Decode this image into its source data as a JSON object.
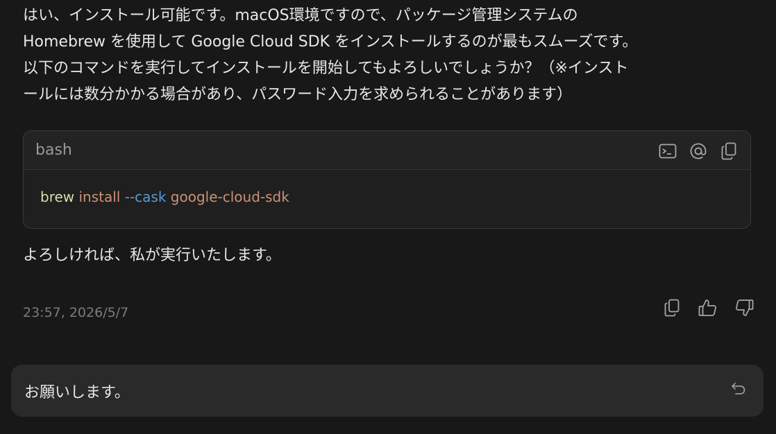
{
  "message": {
    "lines": [
      "はい、インストール可能です。macOS環境ですので、パッケージ管理システムの",
      "Homebrew を使用して Google Cloud SDK をインストールするのが最もスムーズです。",
      "以下のコマンドを実行してインストールを開始してもよろしいでしょうか？（※インスト",
      "ールには数分かかる場合があり、パスワード入力を求められることがあります）"
    ],
    "followup": "よろしければ、私が実行いたします。",
    "timestamp": "23:57, 2026/5/7"
  },
  "code_block": {
    "language": "bash",
    "tokens": {
      "command": "brew",
      "subcommand": "install",
      "flag": "--cask",
      "package": "google-cloud-sdk"
    },
    "tool_icons": [
      "terminal-icon",
      "at-sign-icon",
      "copy-icon"
    ]
  },
  "message_actions": [
    "copy-icon",
    "thumbs-up-icon",
    "thumbs-down-icon"
  ],
  "input": {
    "text": "お願いします。",
    "action_icon": "undo-icon"
  },
  "colors": {
    "background": "#181818",
    "code_command": "#dcdcaa",
    "code_argument": "#ce9178",
    "code_flag": "#569cd6"
  }
}
